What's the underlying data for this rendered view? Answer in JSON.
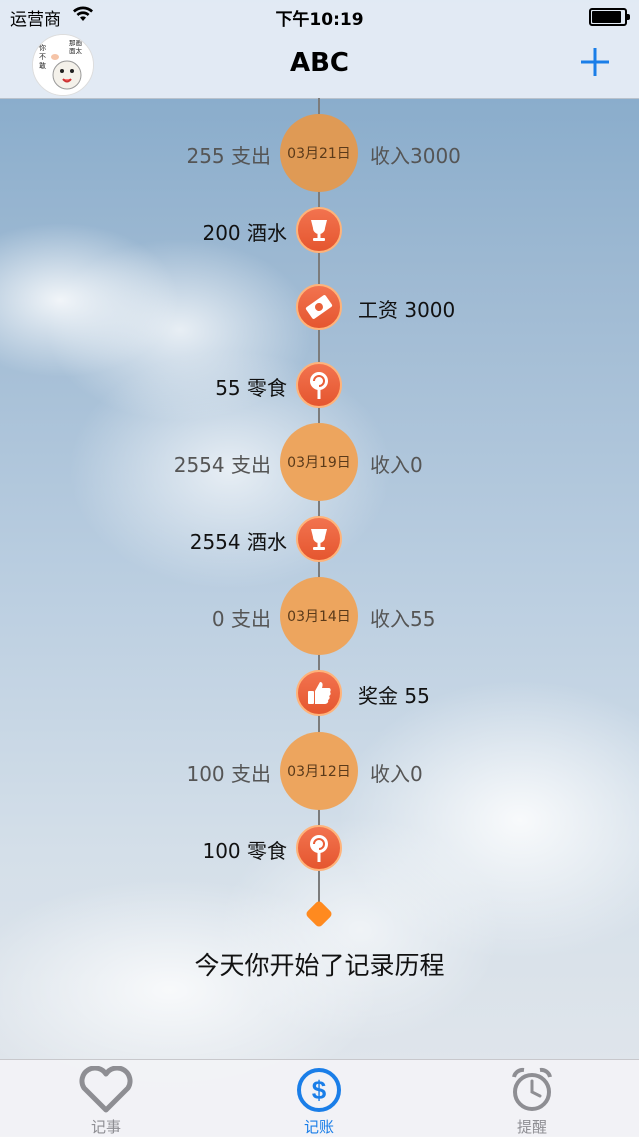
{
  "status_bar": {
    "carrier": "运营商",
    "time": "下午10:19",
    "battery_level": 0.95
  },
  "nav": {
    "title": "ABC",
    "add_icon": "plus-icon",
    "avatar_text": "你就不敢看 那画面太美"
  },
  "timeline": [
    {
      "type": "day",
      "date": "03月21日",
      "left": "255  支出",
      "right": "收入3000",
      "color": "#df9a55"
    },
    {
      "type": "item",
      "icon": "wine-glass-icon",
      "left": "200  酒水",
      "right": ""
    },
    {
      "type": "item",
      "icon": "money-icon",
      "left": "",
      "right": "工资  3000"
    },
    {
      "type": "item",
      "icon": "lollipop-icon",
      "left": "55  零食",
      "right": ""
    },
    {
      "type": "day",
      "date": "03月19日",
      "left": "2554  支出",
      "right": "收入0",
      "color": "#eda55e"
    },
    {
      "type": "item",
      "icon": "wine-glass-icon",
      "left": "2554  酒水",
      "right": ""
    },
    {
      "type": "day",
      "date": "03月14日",
      "left": "0  支出",
      "right": "收入55",
      "color": "#eda55e"
    },
    {
      "type": "item",
      "icon": "thumbs-up-icon",
      "left": "",
      "right": "奖金  55"
    },
    {
      "type": "day",
      "date": "03月12日",
      "left": "100  支出",
      "right": "收入0",
      "color": "#eda55e"
    },
    {
      "type": "item",
      "icon": "lollipop-icon",
      "left": "100  零食",
      "right": ""
    }
  ],
  "footer_message": "今天你开始了记录历程",
  "tabs": [
    {
      "label": "记事",
      "icon": "heart-icon",
      "active": false
    },
    {
      "label": "记账",
      "icon": "dollar-icon",
      "active": true
    },
    {
      "label": "提醒",
      "icon": "alarm-clock-icon",
      "active": false
    }
  ],
  "colors": {
    "accent": "#1a7ee8",
    "inactive": "#8e8e93",
    "item_icon": "#ea5f38",
    "end_marker": "#ff8a1f"
  }
}
